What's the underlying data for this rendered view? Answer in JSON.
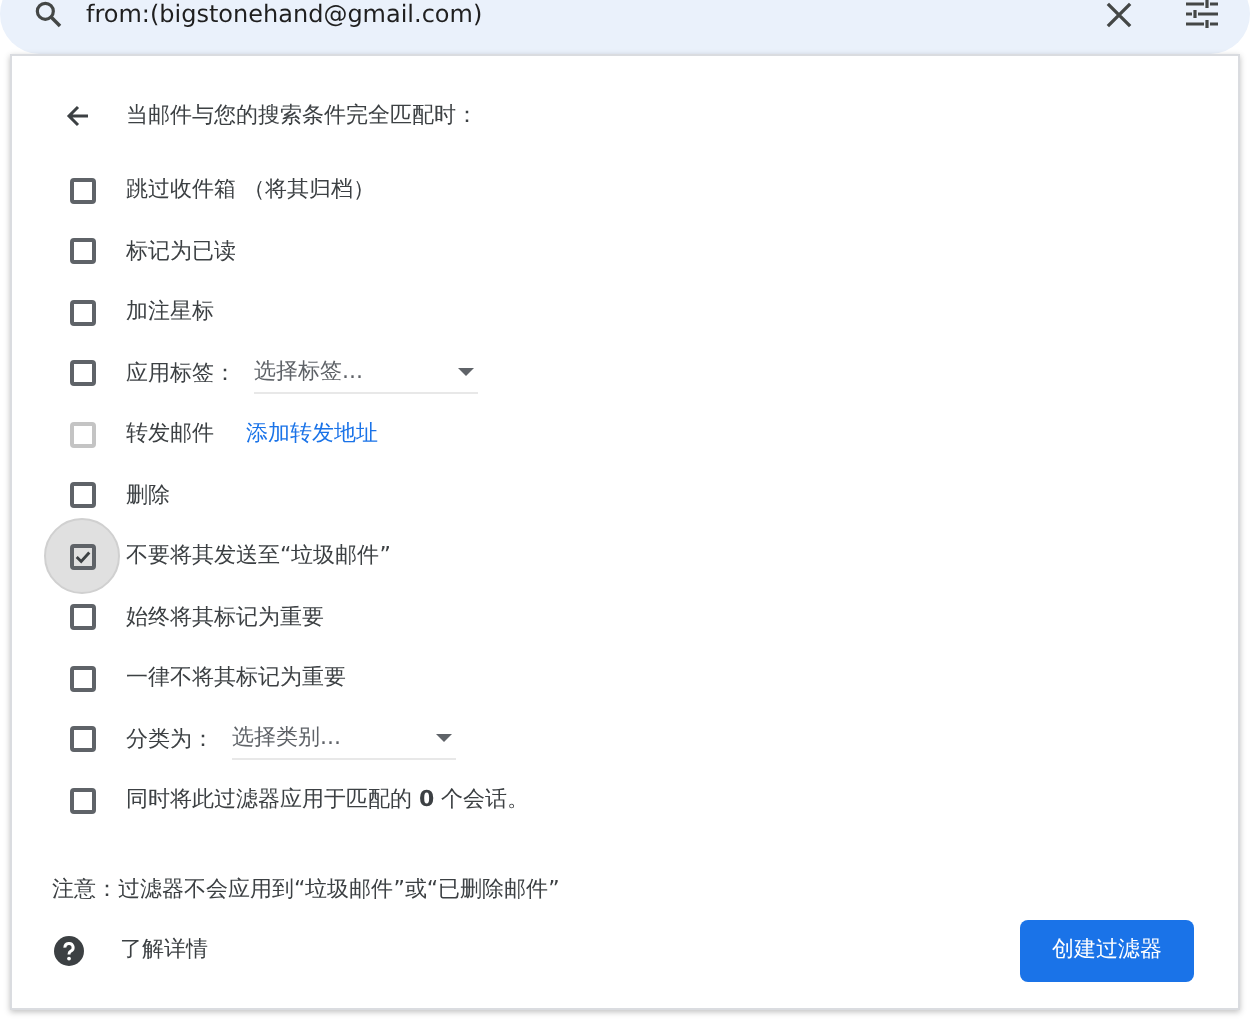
{
  "search": {
    "value": "from:(bigstonehand@gmail.com)"
  },
  "filter": {
    "heading": "当邮件与您的搜索条件完全匹配时：",
    "options": [
      {
        "kind": "checkbox",
        "label": "跳过收件箱 （将其归档）",
        "checked": false,
        "disabled": false,
        "focused": false
      },
      {
        "kind": "checkbox",
        "label": "标记为已读",
        "checked": false,
        "disabled": false,
        "focused": false
      },
      {
        "kind": "checkbox",
        "label": "加注星标",
        "checked": false,
        "disabled": false,
        "focused": false
      },
      {
        "kind": "select",
        "label": "应用标签：",
        "value": "选择标签...",
        "checked": false,
        "disabled": false,
        "focused": false
      },
      {
        "kind": "link",
        "label": "转发邮件",
        "link": "添加转发地址",
        "checked": false,
        "disabled": true,
        "focused": false
      },
      {
        "kind": "checkbox",
        "label": "删除",
        "checked": false,
        "disabled": false,
        "focused": false
      },
      {
        "kind": "checkbox",
        "label": "不要将其发送至“垃圾邮件”",
        "checked": true,
        "disabled": false,
        "focused": true
      },
      {
        "kind": "checkbox",
        "label": "始终将其标记为重要",
        "checked": false,
        "disabled": false,
        "focused": false
      },
      {
        "kind": "checkbox",
        "label": "一律不将其标记为重要",
        "checked": false,
        "disabled": false,
        "focused": false
      },
      {
        "kind": "select",
        "label": "分类为：",
        "value": "选择类别...",
        "checked": false,
        "disabled": false,
        "focused": false
      },
      {
        "kind": "checkbox",
        "label": "同时将此过滤器应用于匹配的 **0** 个会话。",
        "checked": false,
        "disabled": false,
        "focused": false
      }
    ],
    "note": "注意：过滤器不会应用到“垃圾邮件”或“已删除邮件”",
    "learn_more": "了解详情",
    "create_button": "创建过滤器"
  }
}
